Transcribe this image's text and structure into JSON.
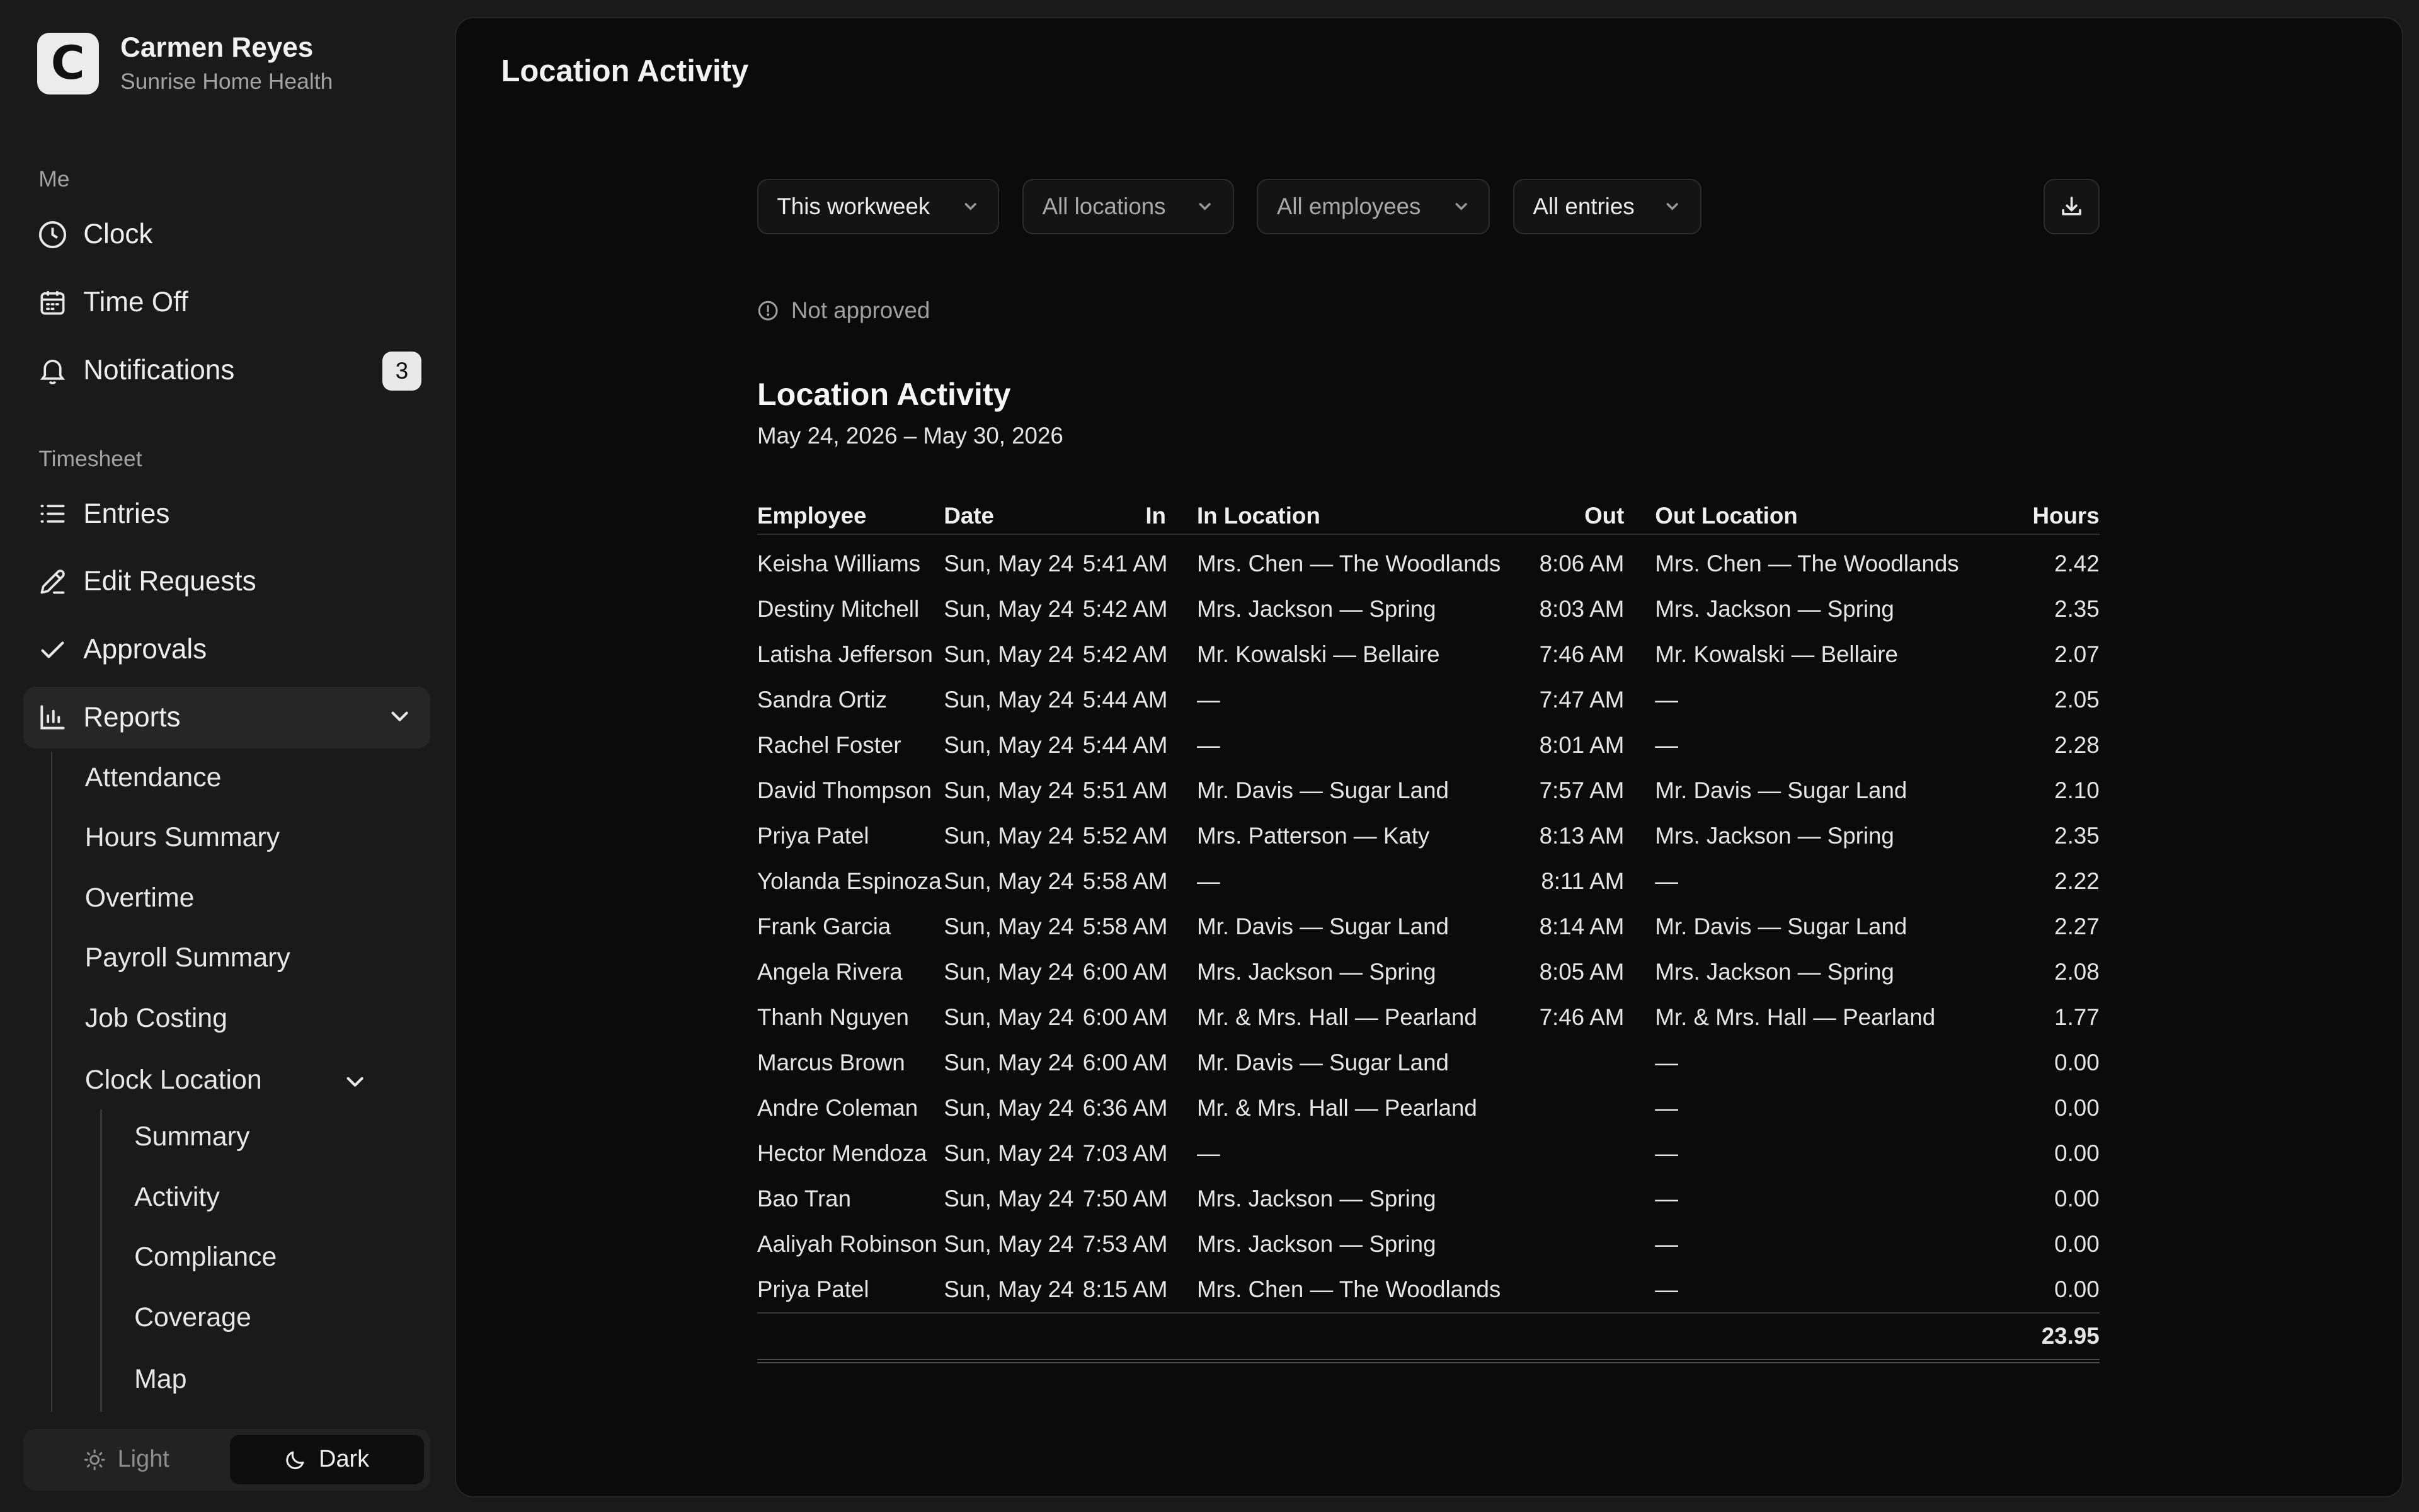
{
  "user": {
    "name": "Carmen Reyes",
    "org": "Sunrise Home Health",
    "logo_letter": "C"
  },
  "nav": {
    "me_label": "Me",
    "clock": "Clock",
    "time_off": "Time Off",
    "notifications": "Notifications",
    "notifications_count": "3",
    "timesheet_label": "Timesheet",
    "entries": "Entries",
    "edit_requests": "Edit Requests",
    "approvals": "Approvals",
    "reports": "Reports",
    "reports_sub": [
      "Attendance",
      "Hours Summary",
      "Overtime",
      "Payroll Summary",
      "Job Costing"
    ],
    "clock_location": "Clock Location",
    "clock_location_sub": [
      "Summary",
      "Activity",
      "Compliance",
      "Coverage",
      "Map"
    ]
  },
  "theme": {
    "light": "Light",
    "dark": "Dark",
    "selected": "Dark"
  },
  "page": {
    "title": "Location Activity"
  },
  "filters": {
    "period": "This workweek",
    "locations": "All locations",
    "employees": "All employees",
    "entries": "All entries"
  },
  "status": "Not approved",
  "report": {
    "title": "Location Activity",
    "range": "May 24, 2026 – May 30, 2026",
    "columns": [
      "Employee",
      "Date",
      "In",
      "In Location",
      "Out",
      "Out Location",
      "Hours"
    ],
    "rows": [
      [
        "Keisha Williams",
        "Sun, May 24",
        "5:41 AM",
        "Mrs. Chen — The Woodlands",
        "8:06 AM",
        "Mrs. Chen — The Woodlands",
        "2.42"
      ],
      [
        "Destiny Mitchell",
        "Sun, May 24",
        "5:42 AM",
        "Mrs. Jackson — Spring",
        "8:03 AM",
        "Mrs. Jackson — Spring",
        "2.35"
      ],
      [
        "Latisha Jefferson",
        "Sun, May 24",
        "5:42 AM",
        "Mr. Kowalski — Bellaire",
        "7:46 AM",
        "Mr. Kowalski — Bellaire",
        "2.07"
      ],
      [
        "Sandra Ortiz",
        "Sun, May 24",
        "5:44 AM",
        "—",
        "7:47 AM",
        "—",
        "2.05"
      ],
      [
        "Rachel Foster",
        "Sun, May 24",
        "5:44 AM",
        "—",
        "8:01 AM",
        "—",
        "2.28"
      ],
      [
        "David Thompson",
        "Sun, May 24",
        "5:51 AM",
        "Mr. Davis — Sugar Land",
        "7:57 AM",
        "Mr. Davis — Sugar Land",
        "2.10"
      ],
      [
        "Priya Patel",
        "Sun, May 24",
        "5:52 AM",
        "Mrs. Patterson — Katy",
        "8:13 AM",
        "Mrs. Jackson — Spring",
        "2.35"
      ],
      [
        "Yolanda Espinoza",
        "Sun, May 24",
        "5:58 AM",
        "—",
        "8:11 AM",
        "—",
        "2.22"
      ],
      [
        "Frank Garcia",
        "Sun, May 24",
        "5:58 AM",
        "Mr. Davis — Sugar Land",
        "8:14 AM",
        "Mr. Davis — Sugar Land",
        "2.27"
      ],
      [
        "Angela Rivera",
        "Sun, May 24",
        "6:00 AM",
        "Mrs. Jackson — Spring",
        "8:05 AM",
        "Mrs. Jackson — Spring",
        "2.08"
      ],
      [
        "Thanh Nguyen",
        "Sun, May 24",
        "6:00 AM",
        "Mr. & Mrs. Hall — Pearland",
        "7:46 AM",
        "Mr. & Mrs. Hall — Pearland",
        "1.77"
      ],
      [
        "Marcus Brown",
        "Sun, May 24",
        "6:00 AM",
        "Mr. Davis — Sugar Land",
        "",
        "—",
        "0.00"
      ],
      [
        "Andre Coleman",
        "Sun, May 24",
        "6:36 AM",
        "Mr. & Mrs. Hall — Pearland",
        "",
        "—",
        "0.00"
      ],
      [
        "Hector Mendoza",
        "Sun, May 24",
        "7:03 AM",
        "—",
        "",
        "—",
        "0.00"
      ],
      [
        "Bao Tran",
        "Sun, May 24",
        "7:50 AM",
        "Mrs. Jackson — Spring",
        "",
        "—",
        "0.00"
      ],
      [
        "Aaliyah Robinson",
        "Sun, May 24",
        "7:53 AM",
        "Mrs. Jackson — Spring",
        "",
        "—",
        "0.00"
      ],
      [
        "Priya Patel",
        "Sun, May 24",
        "8:15 AM",
        "Mrs. Chen — The Woodlands",
        "",
        "—",
        "0.00"
      ]
    ],
    "total_hours": "23.95"
  }
}
